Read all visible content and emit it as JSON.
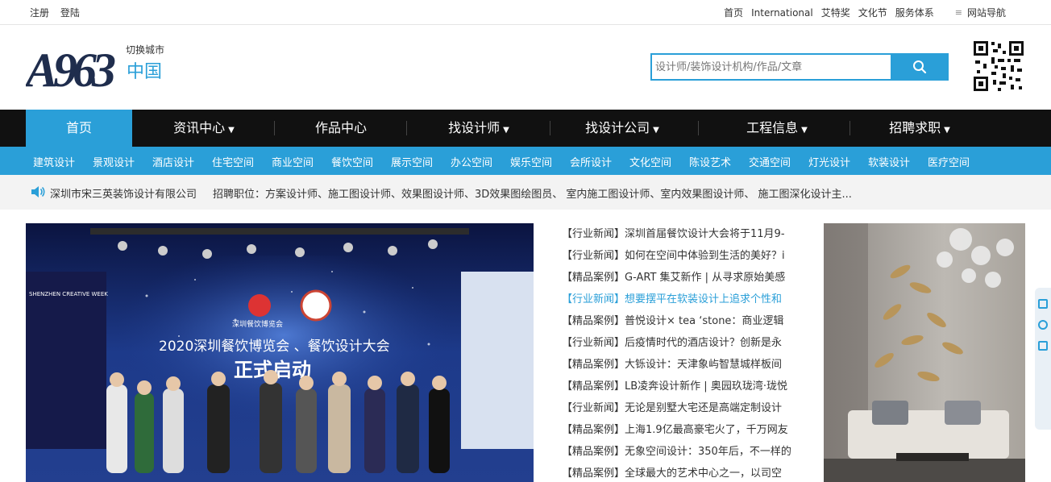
{
  "topbar": {
    "register": "注册",
    "login": "登陆",
    "links": [
      "首页",
      "International",
      "艾特奖",
      "文化节",
      "服务体系"
    ],
    "site_nav": "网站导航"
  },
  "header": {
    "logo_text": "A963",
    "city_switch": "切换城市",
    "city": "中国",
    "search_placeholder": "设计师/装饰设计机构/作品/文章"
  },
  "mainnav": [
    {
      "label": "首页",
      "dropdown": false
    },
    {
      "label": "资讯中心",
      "dropdown": true
    },
    {
      "label": "作品中心",
      "dropdown": false
    },
    {
      "label": "找设计师",
      "dropdown": true
    },
    {
      "label": "找设计公司",
      "dropdown": true
    },
    {
      "label": "工程信息",
      "dropdown": true
    },
    {
      "label": "招聘求职",
      "dropdown": true
    }
  ],
  "subnav": [
    "建筑设计",
    "景观设计",
    "酒店设计",
    "住宅空间",
    "商业空间",
    "餐饮空间",
    "展示空间",
    "办公空间",
    "娱乐空间",
    "会所设计",
    "文化空间",
    "陈设艺术",
    "交通空间",
    "灯光设计",
    "软装设计",
    "医疗空间"
  ],
  "notice": {
    "company": "深圳市宋三英装饰设计有限公司",
    "jobs": "招聘职位：方案设计师、施工图设计师、效果图设计师、3D效果图绘图员、 室内施工图设计师、室内效果图设计师、 施工图深化设计主..."
  },
  "banner": {
    "event_title": "2020深圳餐饮博览会 、餐饮设计大会",
    "event_subtitle": "正式启动",
    "week_text": "SHENZHEN CREATIVE WEEK",
    "expo_brand": "深圳餐饮博览会"
  },
  "news": [
    {
      "tag": "【行业新闻】",
      "title": "深圳首届餐饮设计大会将于11月9-",
      "highlight": false
    },
    {
      "tag": "【行业新闻】",
      "title": "如何在空间中体验到生活的美好？i",
      "highlight": false
    },
    {
      "tag": "【精品案例】",
      "title": "G-ART 集艾新作 | 从寻求原始美感",
      "highlight": false
    },
    {
      "tag": "【行业新闻】",
      "title": "想要摆平在软装设计上追求个性和",
      "highlight": true
    },
    {
      "tag": "【精品案例】",
      "title": "普悦设计× tea ‘stone：商业逻辑",
      "highlight": false
    },
    {
      "tag": "【行业新闻】",
      "title": "后疫情时代的酒店设计？创新是永",
      "highlight": false
    },
    {
      "tag": "【精品案例】",
      "title": "大铄设计：天津象屿智慧城样板间",
      "highlight": false
    },
    {
      "tag": "【精品案例】",
      "title": "LB凌奔设计新作 | 奥园玖珑湾·珑悦",
      "highlight": false
    },
    {
      "tag": "【行业新闻】",
      "title": "无论是别墅大宅还是高端定制设计",
      "highlight": false
    },
    {
      "tag": "【精品案例】",
      "title": "上海1.9亿最高豪宅火了，千万网友",
      "highlight": false
    },
    {
      "tag": "【精品案例】",
      "title": "无象空间设计：350年后，不一样的",
      "highlight": false
    },
    {
      "tag": "【精品案例】",
      "title": "全球最大的艺术中心之一，以司空",
      "highlight": false
    }
  ],
  "colors": {
    "accent": "#2a9fd8",
    "nav_bg": "#111111"
  }
}
